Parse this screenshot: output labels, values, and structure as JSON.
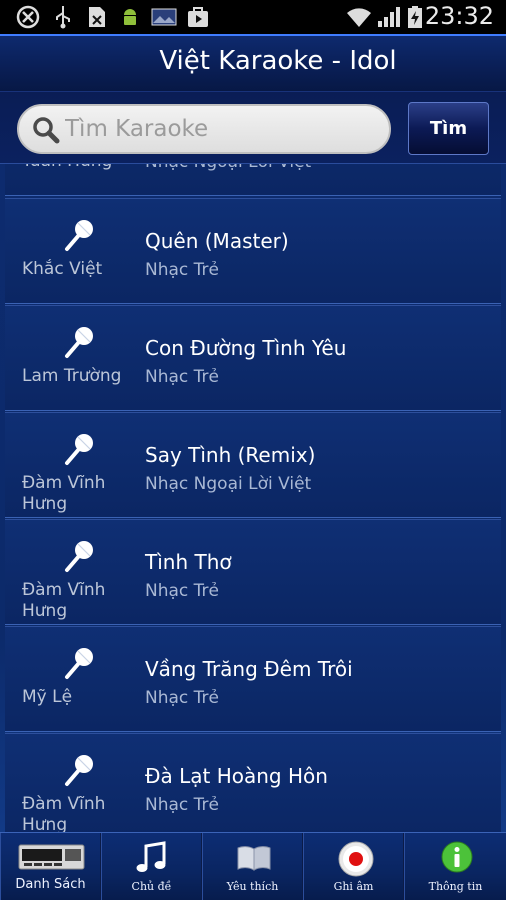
{
  "status_bar": {
    "time": "23:32",
    "icons": [
      "xbox-icon",
      "usb-icon",
      "sim-error-icon",
      "android-debug-icon",
      "photo-icon",
      "play-store-icon",
      "wifi-icon",
      "signal-icon",
      "battery-charging-icon"
    ]
  },
  "header": {
    "title": "Việt Karaoke - Idol"
  },
  "search": {
    "placeholder": "Tìm Karaoke",
    "button_label": "Tìm"
  },
  "songs": [
    {
      "singer": "Tuấn Hưng",
      "title": "",
      "genre": "Nhạc Ngoại Lời Việt"
    },
    {
      "singer": "Khắc Việt",
      "title": "Quên (Master)",
      "genre": "Nhạc Trẻ"
    },
    {
      "singer": "Lam Trường",
      "title": "Con Đường Tình Yêu",
      "genre": "Nhạc Trẻ"
    },
    {
      "singer": "Đàm Vĩnh Hưng",
      "title": "Say Tình (Remix)",
      "genre": "Nhạc Ngoại Lời Việt"
    },
    {
      "singer": "Đàm Vĩnh Hưng",
      "title": "Tình Thơ",
      "genre": "Nhạc Trẻ"
    },
    {
      "singer": "Mỹ Lệ",
      "title": "Vầng Trăng Đêm Trôi",
      "genre": "Nhạc Trẻ"
    },
    {
      "singer": "Đàm Vĩnh Hưng",
      "title": "Đà Lạt Hoàng Hôn",
      "genre": "Nhạc Trẻ"
    }
  ],
  "bottom_nav": [
    {
      "label": "Danh Sách",
      "icon": "cassette-deck-icon"
    },
    {
      "label": "Chủ đề",
      "icon": "music-note-icon"
    },
    {
      "label": "Yêu thích",
      "icon": "book-icon"
    },
    {
      "label": "Ghi âm",
      "icon": "record-icon"
    },
    {
      "label": "Thông tin",
      "icon": "info-icon"
    }
  ],
  "colors": {
    "background": "#0a1a3c",
    "header_accent": "#3f7cff",
    "record_red": "#e01010",
    "info_green": "#4cc23a"
  }
}
